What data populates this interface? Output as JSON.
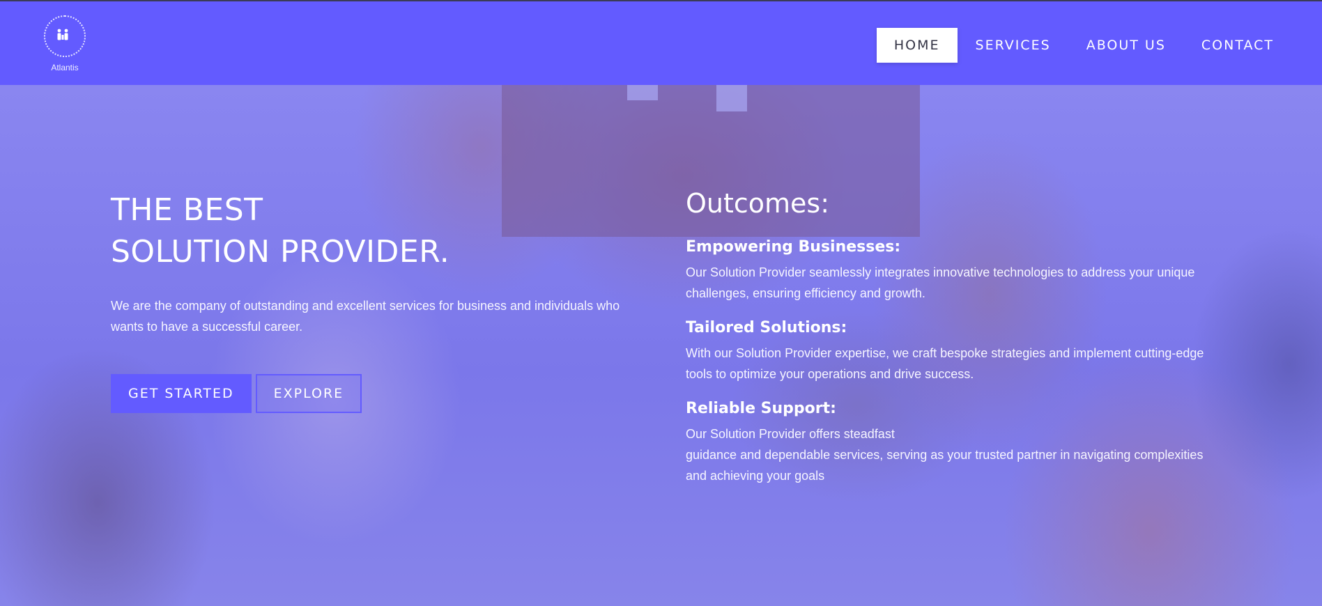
{
  "brand": {
    "logo_ring_text": "solution provider",
    "name": "Atlantis"
  },
  "nav": {
    "items": [
      {
        "label": "HOME",
        "active": true
      },
      {
        "label": "SERVICES",
        "active": false
      },
      {
        "label": "ABOUT US",
        "active": false
      },
      {
        "label": "CONTACT",
        "active": false
      }
    ]
  },
  "hero": {
    "headline_line1": "THE BEST",
    "headline_line2": "SOLUTION PROVIDER.",
    "intro": "We are the company of outstanding and excellent services for business and individuals who wants to have a successful career.",
    "primary_button": "GET STARTED",
    "secondary_button": "EXPLORE"
  },
  "outcomes": {
    "title": "Outcomes:",
    "items": [
      {
        "title": "Empowering Businesses:",
        "text": "Our Solution Provider seamlessly integrates innovative technologies to address your unique challenges, ensuring efficiency and growth."
      },
      {
        "title": "Tailored Solutions:",
        "text": "With our Solution Provider expertise, we craft bespoke strategies and implement cutting-edge tools to optimize your operations and drive success."
      },
      {
        "title": "Reliable Support:",
        "text_line1": "Our Solution Provider offers steadfast",
        "text_line2": "guidance and dependable services, serving as your trusted partner in navigating complexities and achieving your goals"
      }
    ]
  },
  "colors": {
    "brand": "#635bff",
    "overlay": "#7b77ea",
    "text": "#ffffff"
  }
}
